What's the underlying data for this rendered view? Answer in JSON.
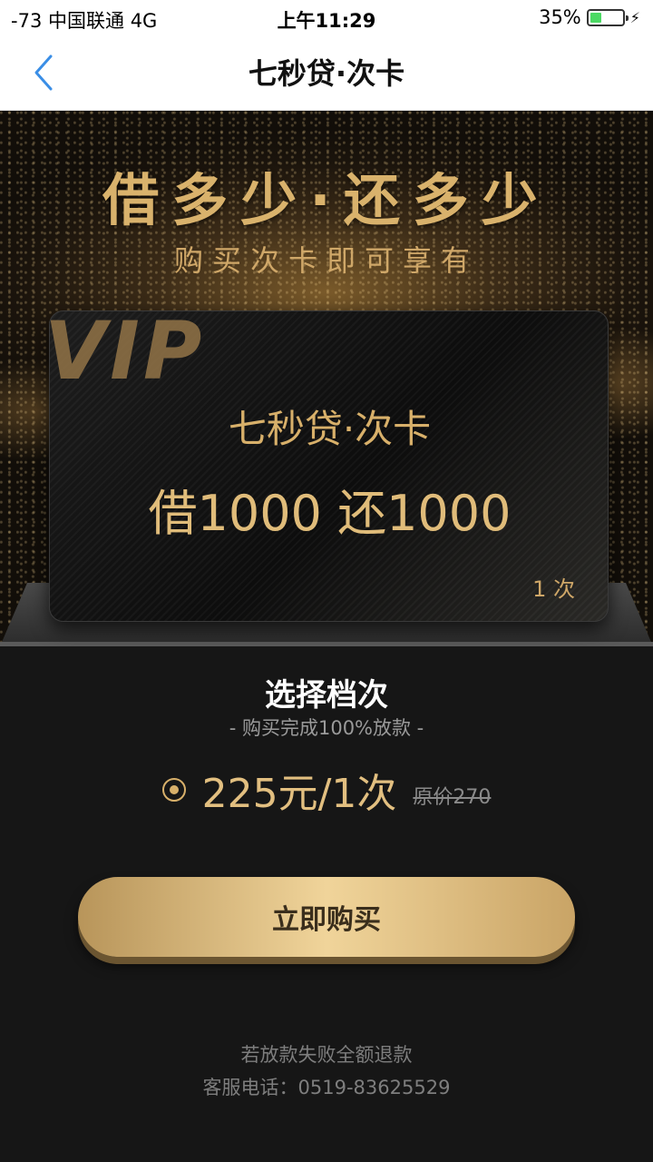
{
  "status_bar": {
    "signal": "-73",
    "carrier": "中国联通",
    "network": "4G",
    "time": "上午11:29",
    "battery_percent_label": "35%",
    "battery_level": 0.35,
    "charging_icon": "bolt-icon"
  },
  "nav": {
    "back_icon": "chevron-left-icon",
    "title": "七秒贷·次卡"
  },
  "hero": {
    "headline": "借多少·还多少",
    "subline": "购买次卡即可享有"
  },
  "card": {
    "badge": "VIP",
    "name": "七秒贷·次卡",
    "amount": "借1000 还1000",
    "count": "1 次"
  },
  "selection": {
    "title": "选择档次",
    "subtitle": "- 购买完成100%放款 -",
    "option": {
      "selected": true,
      "price": "225元/1次",
      "original_price": "原价270"
    }
  },
  "buy_button": {
    "label": "立即购买"
  },
  "footer": {
    "refund_note": "若放款失败全额退款",
    "service_phone": "客服电话：0519-83625529"
  },
  "colors": {
    "gold": "#d8b06a",
    "background": "#161616",
    "ios_blue": "#3a8ee6",
    "battery_green": "#4cd964"
  }
}
